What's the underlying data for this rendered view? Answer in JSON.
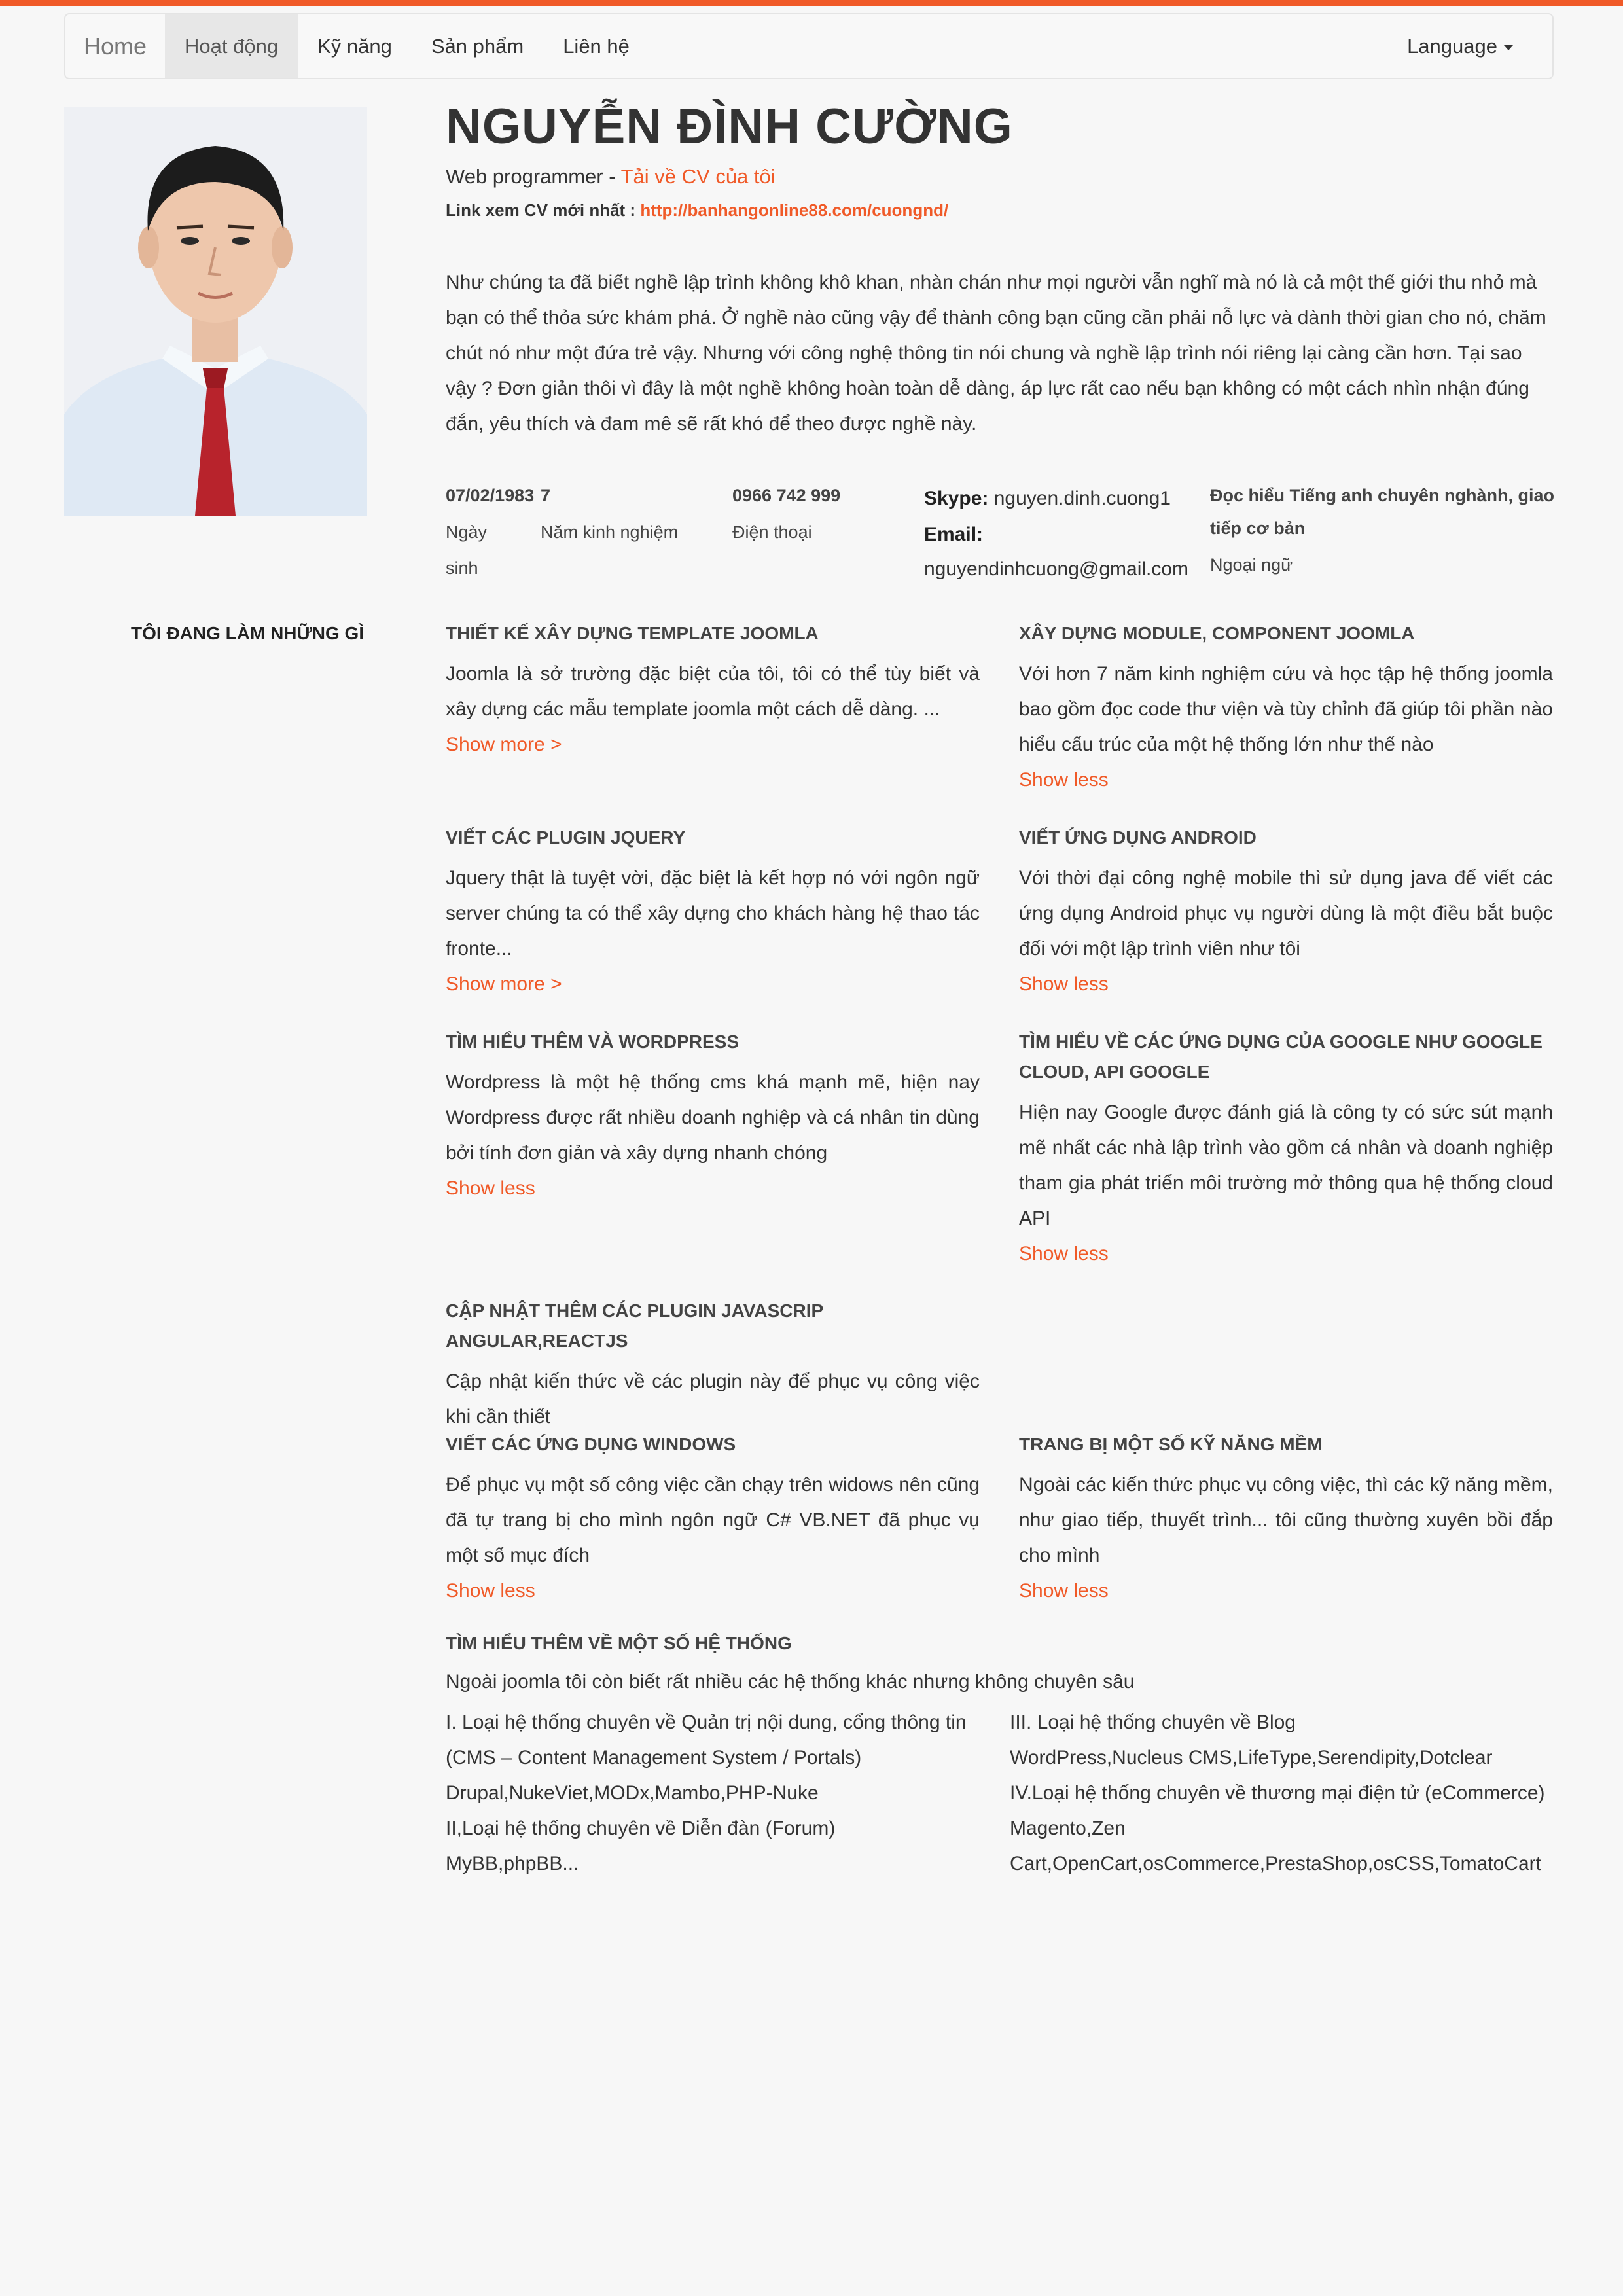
{
  "colors": {
    "accent": "#f05a28",
    "background": "#f7f7f7"
  },
  "nav": {
    "brand": "Home",
    "items": [
      "Hoạt động",
      "Kỹ năng",
      "Sản phẩm",
      "Liên hệ"
    ],
    "language": "Language"
  },
  "profile": {
    "name": "NGUYỄN ĐÌNH CƯỜNG",
    "role": "Web programmer - ",
    "cv_download": "Tải về CV của tôi",
    "cv_link_label": "Link xem CV mới nhất : ",
    "cv_link_url": "http://banhangonline88.com/cuongnd/",
    "intro": "Như chúng ta đã biết nghề lập trình không khô khan, nhàn chán như mọi người vẫn nghĩ mà nó là cả một thế giới thu nhỏ mà bạn có thể thỏa sức khám phá. Ở nghề nào cũng vậy để thành công bạn cũng cần phải nỗ lực và dành thời gian cho nó, chăm chút nó như một đứa trẻ vậy. Nhưng với công nghệ thông tin nói chung và nghề lập trình nói riêng lại càng cần hơn. Tại sao vậy ? Đơn giản thôi vì đây là một nghề không hoàn toàn dễ dàng, áp lực rất cao nếu bạn không có một cách nhìn nhận đúng đắn, yêu thích và đam mê sẽ rất khó để theo được nghề này."
  },
  "stats": {
    "birthday": {
      "value": "07/02/1983",
      "label_1": "Ngày",
      "label_2": "sinh"
    },
    "experience": {
      "value": "7",
      "label": "Năm kinh nghiệm"
    },
    "phone": {
      "value": "0966 742 999",
      "label": "Điện thoại"
    },
    "skype": {
      "label": "Skype:",
      "value": "nguyen.dinh.cuong1"
    },
    "email": {
      "label": "Email:",
      "value": "nguyendinhcuong@gmail.com"
    },
    "language": {
      "value_1": "Đọc hiểu Tiếng anh chuyên nghành, giao",
      "value_2": "tiếp cơ bản",
      "label": "Ngoại ngữ"
    }
  },
  "doing": {
    "section_title": "TÔI ĐANG LÀM NHỮNG GÌ",
    "skills": [
      {
        "title": "THIẾT KẾ XÂY DỰNG TEMPLATE JOOMLA",
        "desc": "Joomla là sở trường đặc biệt của tôi, tôi có thể tùy biết và xây dựng các mẫu template joomla một cách dễ dàng. ...",
        "more": "Show more >"
      },
      {
        "title": "XÂY DỰNG MODULE, COMPONENT JOOMLA",
        "desc": "Với hơn 7 năm kinh nghiệm cứu và học tập hệ thống joomla bao gồm đọc code thư viện và tùy chỉnh đã giúp tôi phần nào hiểu cấu trúc của một hệ thống lớn như thế nào",
        "more": "Show less"
      },
      {
        "title": "VIẾT CÁC PLUGIN JQUERY",
        "desc": "Jquery thật là tuyệt vời, đặc biệt là kết hợp nó với ngôn ngữ server chúng ta có thể xây dựng cho khách hàng hệ thao tác fronte...",
        "more": "Show more >"
      },
      {
        "title": "VIẾT ỨNG DỤNG ANDROID",
        "desc": "Với thời đại công nghệ mobile thì sử dụng java để viết các ứng dụng Android phục vụ người dùng là một điều bắt buộc đối với một lập trình viên như tôi",
        "more": "Show less"
      },
      {
        "title": "TÌM HIỂU THÊM VÀ WORDPRESS",
        "desc": "Wordpress là một hệ thống cms khá mạnh mẽ, hiện nay Wordpress được rất nhiều doanh nghiệp và cá nhân tin dùng bởi tính đơn giản và xây dựng nhanh chóng",
        "more": "Show less"
      },
      {
        "title": "TÌM HIỂU VỀ CÁC ỨNG DỤNG CỦA GOOGLE NHƯ GOOGLE CLOUD, API GOOGLE",
        "desc": "Hiện nay Google được đánh giá là công ty có sức sút mạnh mẽ nhất các nhà lập trình vào gồm cá nhân và doanh nghiệp tham gia phát triển môi trường mở thông qua hệ thống cloud API",
        "more": "Show less"
      },
      {
        "title": "CẬP NHẬT THÊM CÁC PLUGIN JAVASCRIP ANGULAR,REACTJS",
        "desc": "Cập nhật kiến thức về các plugin này để phục vụ công việc khi cần thiết",
        "more": ""
      },
      {
        "title": "VIẾT CÁC ỨNG DỤNG WINDOWS",
        "desc": "Để phục vụ một số công việc cần chạy trên widows nên cũng đã tự trang bị cho mình ngôn ngữ C# VB.NET đã phục vụ một số mục đích",
        "more": "Show less"
      },
      {
        "title": "TRANG BỊ MỘT SỐ KỸ NĂNG MỀM",
        "desc": "Ngoài các kiến thức phục vụ công việc, thì các kỹ năng mềm, như giao tiếp, thuyết trình... tôi cũng thường xuyên bồi đắp cho mình",
        "more": "Show less"
      }
    ]
  },
  "systems": {
    "title": "TÌM HIỂU THÊM VỀ MỘT SỐ HỆ THỐNG",
    "intro": "Ngoài joomla tôi còn biết rất nhiều các hệ thống khác nhưng không chuyên sâu",
    "left": [
      "I. Loại hệ thống chuyên về Quản trị nội dung, cổng thông tin",
      "(CMS – Content Management System / Portals)",
      "Drupal,NukeViet,MODx,Mambo,PHP-Nuke",
      "II,Loại hệ thống chuyên về Diễn đàn (Forum)",
      "MyBB,phpBB..."
    ],
    "right": [
      "III. Loại hệ thống chuyên về Blog",
      "WordPress,Nucleus CMS,LifeType,Serendipity,Dotclear",
      "IV.Loại hệ thống chuyên về thương mại điện tử (eCommerce)",
      "Magento,Zen",
      "Cart,OpenCart,osCommerce,PrestaShop,osCSS,TomatoCart"
    ]
  }
}
